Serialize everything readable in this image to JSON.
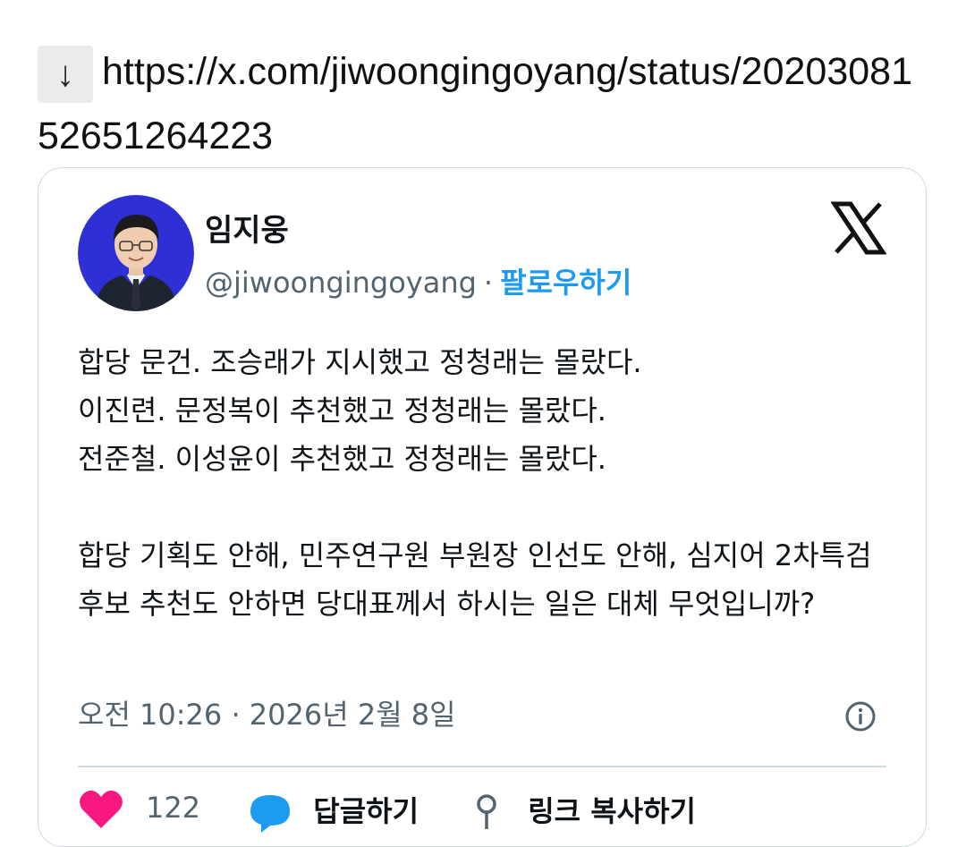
{
  "link": {
    "arrow_icon": "down-arrow-icon",
    "arrow": "↓",
    "url": "https://x.com/jiwoongingoyang/status/2020308152651264223"
  },
  "tweet": {
    "author_name": "임지웅",
    "handle": "@jiwoongingoyang",
    "separator": "·",
    "follow_label": "팔로우하기",
    "logo_icon": "x-logo-icon",
    "lines": [
      "합당 문건. 조승래가 지시했고 정청래는 몰랐다.",
      "이진련. 문정복이 추천했고 정청래는 몰랐다.",
      "전준철. 이성윤이 추천했고 정청래는 몰랐다."
    ],
    "paragraph2": "합당 기획도 안해, 민주연구원 부원장 인선도 안해, 심지어 2차특검 후보 추천도 안하면 당대표께서 하시는 일은 대체 무엇입니까?",
    "timestamp": "오전 10:26 · 2026년 2월 8일",
    "info_icon": "info-icon"
  },
  "actions": {
    "like_icon": "heart-icon",
    "like_count": "122",
    "reply_icon": "reply-icon",
    "reply_label": "답글하기",
    "copy_icon": "link-icon",
    "copy_label": "링크 복사하기"
  },
  "colors": {
    "accent": "#1d9bf0",
    "muted": "#536471",
    "border": "#cfd9de",
    "like": "#f91880",
    "avatar_bg": "#2f2fd6"
  }
}
